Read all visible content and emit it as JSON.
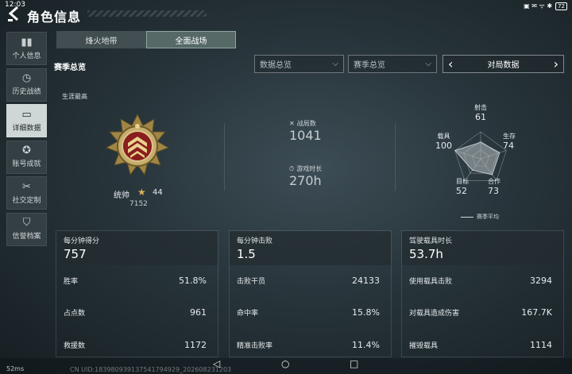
{
  "status_bar": {
    "time": "12:03",
    "battery": "72",
    "signal": "▣ ✉ ᯤ ✱"
  },
  "header": {
    "back_icon": "arrow-back-icon",
    "title": "角色信息"
  },
  "sidebar": {
    "items": [
      {
        "label": "个人信息",
        "icon": "bar-chart-icon",
        "glyph": "▮▮"
      },
      {
        "label": "历史战绩",
        "icon": "clock-icon",
        "glyph": "◷"
      },
      {
        "label": "详细数据",
        "icon": "folder-icon",
        "glyph": "▭",
        "active": true
      },
      {
        "label": "账号成就",
        "icon": "medal-icon",
        "glyph": "✪"
      },
      {
        "label": "社交定制",
        "icon": "wrench-icon",
        "glyph": "✂"
      },
      {
        "label": "信誉档案",
        "icon": "shield-icon",
        "glyph": "⛉"
      }
    ]
  },
  "tabs": [
    {
      "label": "烽火地带"
    },
    {
      "label": "全面战场",
      "active": true
    }
  ],
  "section": {
    "title": "赛季总览"
  },
  "filters": {
    "data_overview": "数据总览",
    "season_overview": "赛季总览",
    "match_data": "对局数据",
    "chevron_down": "⌵",
    "prev": "‹",
    "next": "›"
  },
  "career": {
    "label": "生涯最高",
    "rank_name": "统帅",
    "rank_star": "★",
    "rank_level": "44",
    "rank_points": "7152"
  },
  "battles": {
    "label": "战局数",
    "value": "1041",
    "icon": "crossed-swords-icon",
    "glyph": "✕"
  },
  "playtime": {
    "label": "游戏时长",
    "value": "270h",
    "icon": "stopwatch-icon",
    "glyph": "⏱"
  },
  "radar": {
    "axes": [
      {
        "label": "射击",
        "value": "61"
      },
      {
        "label": "生存",
        "value": "74"
      },
      {
        "label": "合作",
        "value": "73"
      },
      {
        "label": "目标",
        "value": "52"
      },
      {
        "label": "载具",
        "value": "100"
      }
    ],
    "legend": "赛季平均"
  },
  "panels": [
    {
      "label": "每分钟得分",
      "value": "757",
      "rows": [
        {
          "label": "胜率",
          "value": "51.8%"
        },
        {
          "label": "占点数",
          "value": "961"
        },
        {
          "label": "救援数",
          "value": "1172"
        }
      ]
    },
    {
      "label": "每分钟击败",
      "value": "1.5",
      "rows": [
        {
          "label": "击败干员",
          "value": "24133"
        },
        {
          "label": "命中率",
          "value": "15.8%"
        },
        {
          "label": "精准击败率",
          "value": "11.4%"
        }
      ]
    },
    {
      "label": "驾驶载具时长",
      "value": "53.7h",
      "rows": [
        {
          "label": "使用载具击败",
          "value": "3294"
        },
        {
          "label": "对载具造成伤害",
          "value": "167.7K"
        },
        {
          "label": "摧毁载具",
          "value": "1114"
        }
      ]
    }
  ],
  "footer": {
    "ping": "52ms",
    "uid": "CN UID:183980939137541794929_202608231203",
    "nav_back": "◁",
    "nav_home": "○",
    "nav_recent": "□"
  },
  "colors": {
    "accent_gold": "#d9b45a",
    "badge_red": "#8a1d1d",
    "active_tab": "#8fa5a0"
  }
}
